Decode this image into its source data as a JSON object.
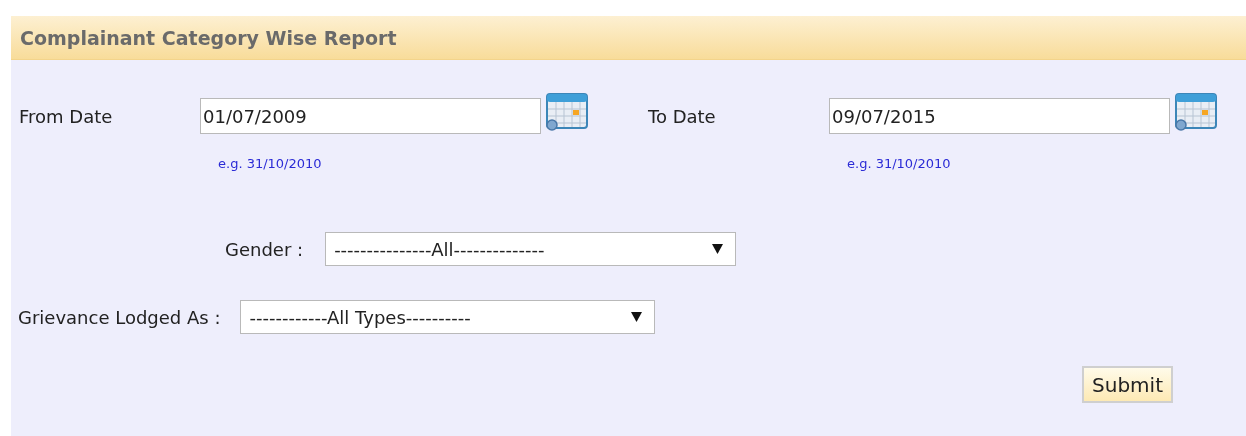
{
  "title": "Complainant Category Wise Report",
  "date_fields": [
    {
      "label": "From Date",
      "value": "01/07/2009",
      "hint": "e.g. 31/10/2010"
    },
    {
      "label": "To Date",
      "value": "09/07/2015",
      "hint": "e.g. 31/10/2010"
    }
  ],
  "selects": [
    {
      "label": "Gender :",
      "value": "---------------All--------------"
    },
    {
      "label": "Grievance Lodged As :",
      "value": "------------All Types----------"
    }
  ],
  "submit": "Submit"
}
